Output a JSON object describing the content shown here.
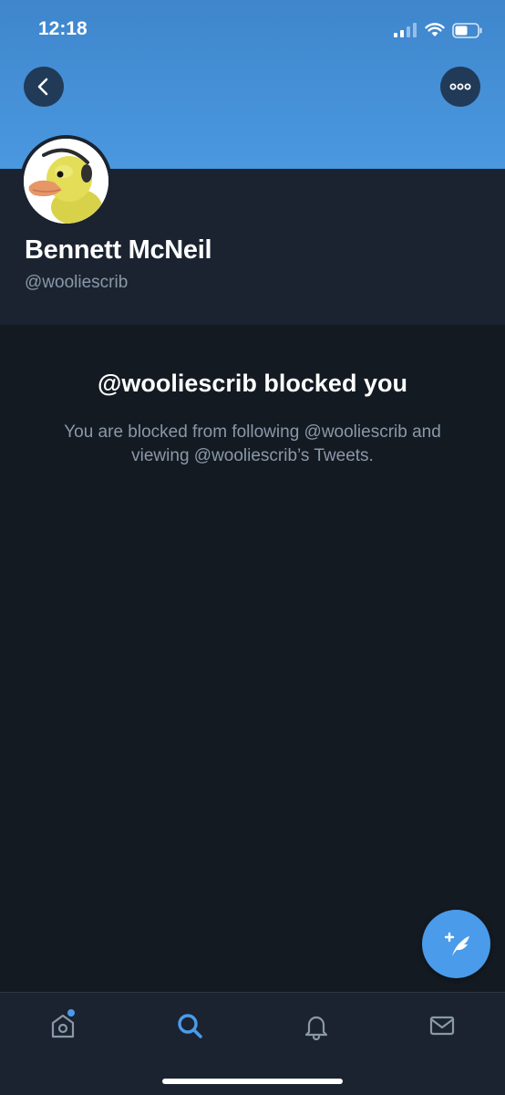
{
  "status_bar": {
    "time": "12:18"
  },
  "profile": {
    "display_name": "Bennett McNeil",
    "handle": "@wooliescrib"
  },
  "blocked": {
    "title": "@wooliescrib blocked you",
    "description": "You are blocked from following @wooliescrib and viewing @wooliescrib’s Tweets."
  },
  "icons": {
    "back": "chevron-left-icon",
    "more": "ellipsis-icon",
    "compose": "compose-tweet-icon",
    "home": "home-icon",
    "search": "search-icon",
    "notifications": "bell-icon",
    "messages": "mail-icon"
  },
  "tab_bar": {
    "active_tab": "search",
    "home_has_unread": true
  },
  "colors": {
    "accent": "#4a9bea",
    "banner": "#4a98e0",
    "background": "#141a22",
    "panel": "#1b2330",
    "secondary_text": "#8a98a8"
  }
}
